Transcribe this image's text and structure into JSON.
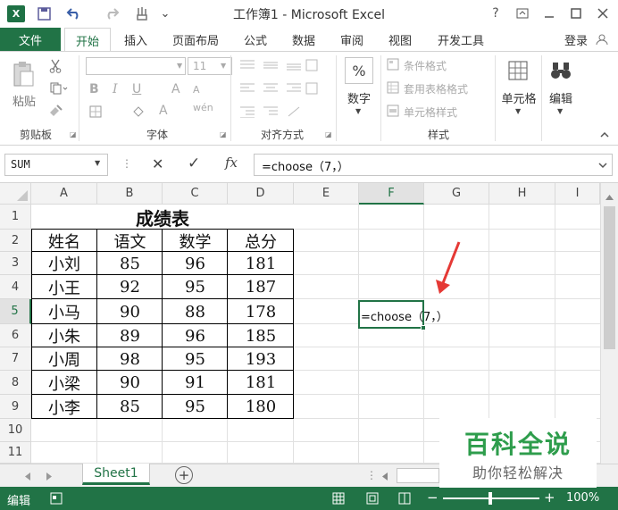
{
  "title_bar": {
    "title": "工作簿1 - Microsoft Excel",
    "app_badge": "X",
    "help": "?",
    "qat_extra": "⌄"
  },
  "tabs": {
    "file": "文件",
    "items": [
      "开始",
      "插入",
      "页面布局",
      "公式",
      "数据",
      "审阅",
      "视图",
      "开发工具"
    ],
    "active_index": 0,
    "login": "登录"
  },
  "ribbon": {
    "clipboard": {
      "paste": "粘贴",
      "label": "剪贴板"
    },
    "font": {
      "size": "11",
      "bold": "B",
      "italic": "I",
      "underline": "U",
      "grow": "A",
      "shrink": "A",
      "wen": "wén",
      "fontcolor": "A",
      "label": "字体"
    },
    "alignment": {
      "label": "对齐方式"
    },
    "number": {
      "pct": "%",
      "name": "数字"
    },
    "styles": {
      "conditional": "条件格式",
      "table": "套用表格格式",
      "cell": "单元格样式",
      "label": "样式"
    },
    "cells": {
      "name": "单元格"
    },
    "editing": {
      "name": "编辑"
    }
  },
  "formula_bar": {
    "name_box": "SUM",
    "fx": "fx",
    "cancel": "✕",
    "enter": "✓",
    "formula": "=choose（7，）"
  },
  "grid": {
    "columns": [
      "A",
      "B",
      "C",
      "D",
      "E",
      "F",
      "G",
      "H",
      "I"
    ],
    "selected_column": "F",
    "rows": [
      "1",
      "2",
      "3",
      "4",
      "5",
      "6",
      "7",
      "8",
      "9",
      "10",
      "11"
    ],
    "selected_row": "5",
    "table_title": "成绩表",
    "headers": [
      "姓名",
      "语文",
      "数学",
      "总分"
    ],
    "records": [
      [
        "小刘",
        "85",
        "96",
        "181"
      ],
      [
        "小王",
        "92",
        "95",
        "187"
      ],
      [
        "小马",
        "90",
        "88",
        "178"
      ],
      [
        "小朱",
        "89",
        "96",
        "185"
      ],
      [
        "小周",
        "98",
        "95",
        "193"
      ],
      [
        "小梁",
        "90",
        "91",
        "181"
      ],
      [
        "小李",
        "85",
        "95",
        "180"
      ]
    ],
    "editing_cell": "F5",
    "editing_text": "=choose（7，）"
  },
  "sheets": {
    "tabs": [
      "Sheet1"
    ],
    "add": "+"
  },
  "status": {
    "mode": "编辑",
    "zoom": "100%",
    "zoom_minus": "−",
    "zoom_plus": "+"
  },
  "watermark": {
    "title": "百科全说",
    "subtitle": "助你轻松解决"
  },
  "colors": {
    "excel_green": "#217346",
    "arrow_red": "#e53935"
  }
}
